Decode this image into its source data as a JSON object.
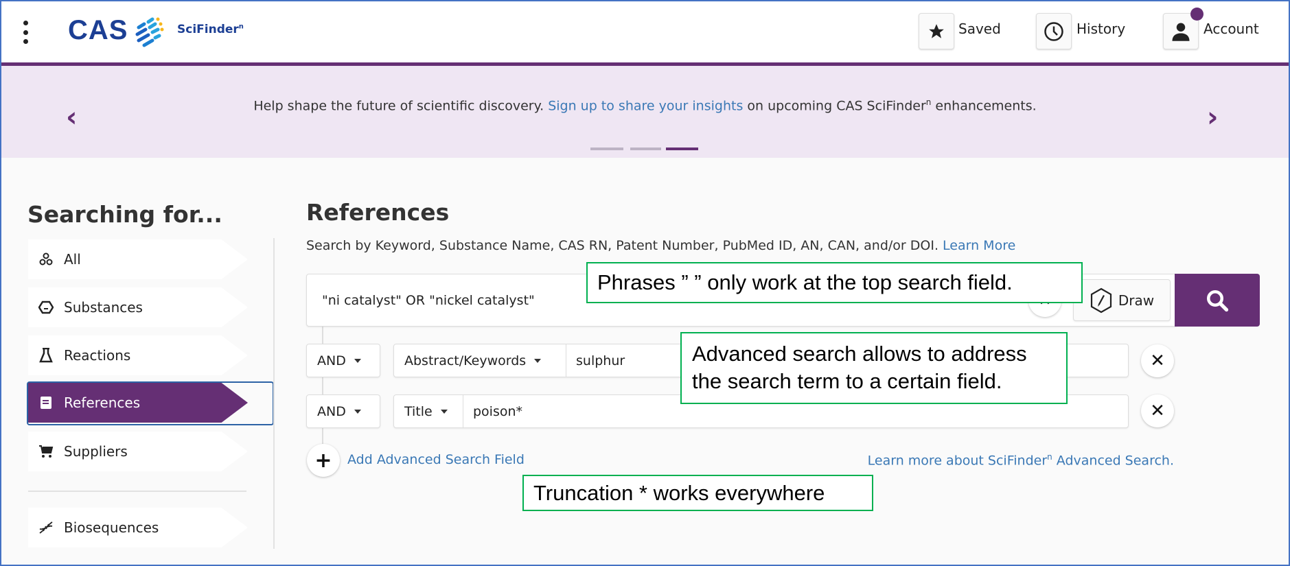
{
  "header": {
    "logo": "CAS",
    "product": "SciFinder",
    "product_sup": "n",
    "saved": "Saved",
    "history": "History",
    "account": "Account",
    "accent": "#652f74"
  },
  "banner": {
    "text_before": "Help shape the future of scientific discovery. ",
    "link": "Sign up to share your insights",
    "text_after": " on upcoming CAS SciFinder",
    "sup": "n",
    "text_end": " enhancements.",
    "slides": 3,
    "active_slide": 3
  },
  "sidebar": {
    "title": "Searching for...",
    "items": [
      {
        "label": "All",
        "icon": "molecules-icon"
      },
      {
        "label": "Substances",
        "icon": "hexagon-icon"
      },
      {
        "label": "Reactions",
        "icon": "flask-icon"
      },
      {
        "label": "References",
        "icon": "document-icon",
        "selected": true
      },
      {
        "label": "Suppliers",
        "icon": "cart-icon"
      },
      {
        "label": "Biosequences",
        "icon": "dna-icon"
      }
    ]
  },
  "main": {
    "title": "References",
    "description": "Search by Keyword, Substance Name, CAS RN, Patent Number, PubMed ID, AN, CAN, and/or DOI. ",
    "learn_more": "Learn More",
    "query": "\"ni catalyst\" OR \"nickel catalyst\"",
    "draw": "Draw",
    "rows": [
      {
        "operator": "AND",
        "field": "Abstract/Keywords",
        "value": "sulphur"
      },
      {
        "operator": "AND",
        "field": "Title",
        "value": "poison*"
      }
    ],
    "add_field": "Add Advanced Search Field",
    "learn_advanced": "Learn more about SciFinder",
    "learn_advanced_sup": "n",
    "learn_advanced_end": " Advanced Search."
  },
  "annotations": [
    "Phrases ”  ” only work at the top search field.",
    "Advanced search allows to address the search term to a certain field.",
    "Truncation * works everywhere"
  ]
}
